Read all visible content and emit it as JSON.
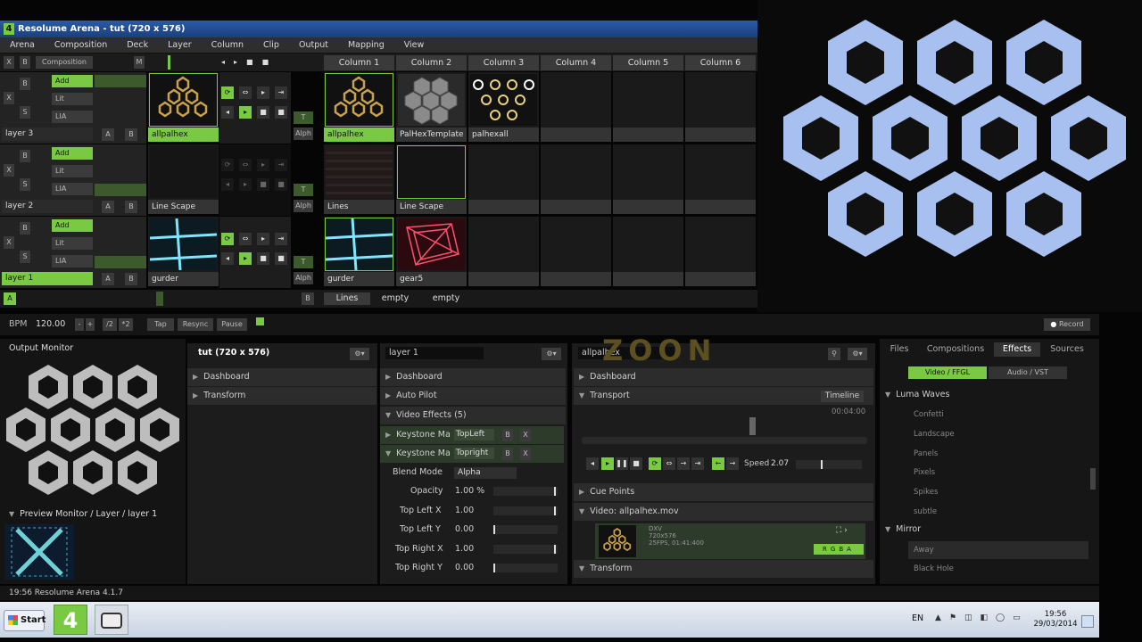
{
  "window": {
    "title": "Resolume Arena - tut (720 x 576)",
    "logo": "4"
  },
  "menu": [
    "Arena",
    "Composition",
    "Deck",
    "Layer",
    "Column",
    "Clip",
    "Output",
    "Mapping",
    "View"
  ],
  "toprow": {
    "x": "X",
    "b": "B",
    "composition": "Composition",
    "m": "M"
  },
  "columns": [
    "Column 1",
    "Column 2",
    "Column 3",
    "Column 4",
    "Column 5",
    "Column 6"
  ],
  "layers": [
    {
      "name": "layer 3",
      "add": "Add",
      "lit": "Lit",
      "lia": "LIA",
      "b": "B",
      "s": "S",
      "x": "X",
      "a": "A",
      "bb": "B",
      "current_clip": "allpalhex",
      "alpha": "Alph"
    },
    {
      "name": "layer 2",
      "add": "Add",
      "lit": "Lit",
      "lia": "LIA",
      "b": "B",
      "s": "S",
      "x": "X",
      "a": "A",
      "bb": "B",
      "current_clip": "Line Scape",
      "alpha": "Alph"
    },
    {
      "name": "layer 1",
      "add": "Add",
      "lit": "Lit",
      "lia": "LIA",
      "b": "B",
      "s": "S",
      "x": "X",
      "a": "A",
      "bb": "B",
      "current_clip": "gurder",
      "alpha": "Alph"
    }
  ],
  "clips": {
    "layer3": [
      "allpalhex",
      "PalHexTemplate",
      "palhexall"
    ],
    "layer2": [
      "Lines",
      "Line Scape"
    ],
    "layer1": [
      "gurder",
      "gear5"
    ]
  },
  "deckbar": {
    "a": "A",
    "b": "B",
    "decks": [
      "Lines",
      "empty",
      "empty"
    ]
  },
  "bpmbar": {
    "bpm_label": "BPM",
    "bpm_value": "120.00",
    "minus": "-",
    "plus": "+",
    "div2": "/2",
    "mul2": "*2",
    "tap": "Tap",
    "resync": "Resync",
    "pause": "Pause",
    "record": "Record"
  },
  "output_monitor": {
    "title": "Output Monitor"
  },
  "preview_monitor": {
    "title": "Preview Monitor / Layer / layer 1"
  },
  "composition_panel": {
    "title": "tut (720 x 576)",
    "rows": [
      "Dashboard",
      "Transform"
    ]
  },
  "layer_panel": {
    "title": "layer 1",
    "rows": [
      "Dashboard",
      "Auto Pilot",
      "Video Effects (5)"
    ],
    "effects": [
      {
        "name": "Keystone Ma",
        "mode": "TopLeft"
      },
      {
        "name": "Keystone Ma",
        "mode": "Topright"
      }
    ],
    "params": [
      {
        "label": "Blend Mode",
        "value": "Alpha"
      },
      {
        "label": "Opacity",
        "value": "1.00 %"
      },
      {
        "label": "Top Left X",
        "value": "1.00"
      },
      {
        "label": "Top Left Y",
        "value": "0.00"
      },
      {
        "label": "Top Right X",
        "value": "1.00"
      },
      {
        "label": "Top Right Y",
        "value": "0.00"
      }
    ]
  },
  "clip_panel": {
    "title": "allpalhex",
    "rows": [
      "Dashboard",
      "Transport"
    ],
    "timeline": "Timeline",
    "time": "00:04:00",
    "speed_label": "Speed",
    "speed_value": "2.07",
    "cue": "Cue Points",
    "video": "Video: allpalhex.mov",
    "video_info": [
      "DXV",
      "720x576",
      "25FPS, 01:41:400"
    ],
    "transform": "Transform"
  },
  "browser": {
    "tabs": [
      "Files",
      "Compositions",
      "Effects",
      "Sources"
    ],
    "subtabs": [
      "Video / FFGL",
      "Audio / VST"
    ],
    "groups": [
      {
        "name": "Luma Waves",
        "items": [
          "Confetti",
          "Landscape",
          "Panels",
          "Pixels",
          "Spikes",
          "subtle"
        ]
      },
      {
        "name": "Mirror",
        "items": [
          "Away",
          "Black Hole"
        ]
      }
    ]
  },
  "status": {
    "text": "19:56  Resolume Arena 4.1.7"
  },
  "taskbar": {
    "start": "Start",
    "lang": "EN",
    "time": "19:56",
    "date": "29/03/2014"
  },
  "colors": {
    "accent": "#7ac943",
    "hex_blue": "#a8c0f0"
  }
}
